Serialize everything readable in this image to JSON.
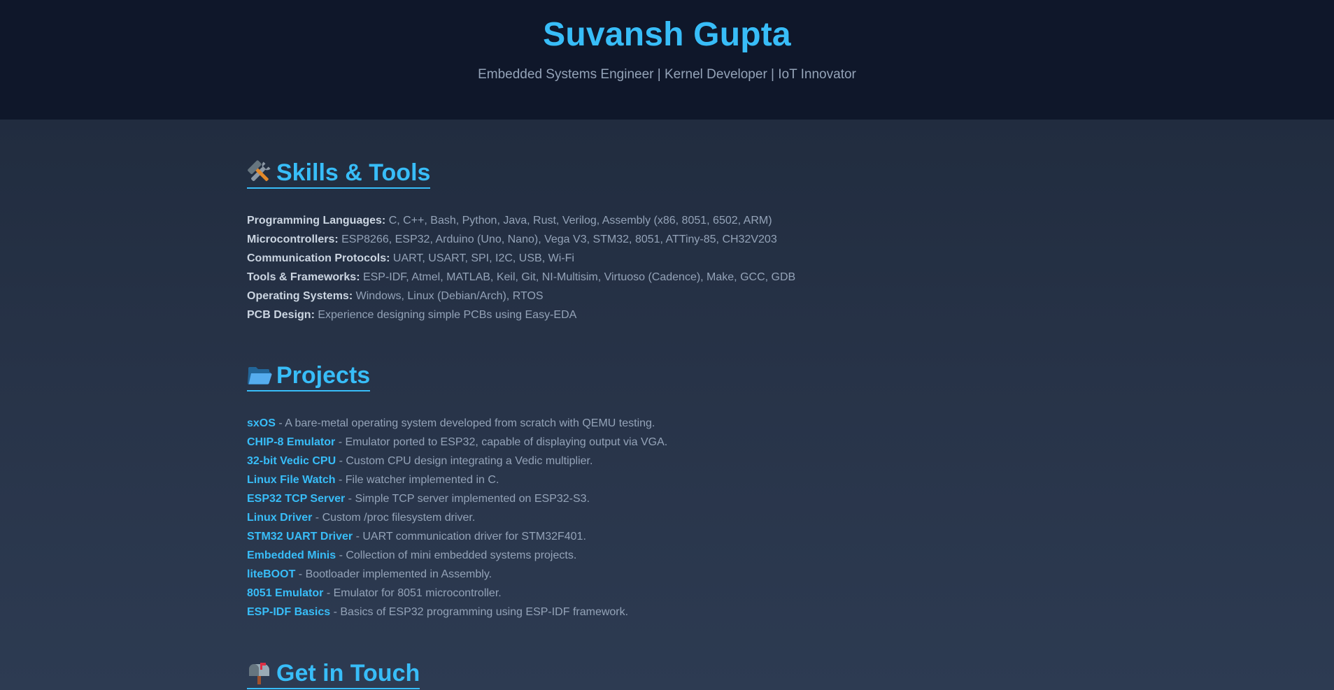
{
  "header": {
    "name": "Suvansh Gupta",
    "tagline": "Embedded Systems Engineer | Kernel Developer | IoT Innovator"
  },
  "skills": {
    "icon": "hammer-and-wrench-icon",
    "title": "Skills & Tools",
    "items": [
      {
        "label": "Programming Languages:",
        "value": " C, C++, Bash, Python, Java, Rust, Verilog, Assembly (x86, 8051, 6502, ARM)"
      },
      {
        "label": "Microcontrollers:",
        "value": " ESP8266, ESP32, Arduino (Uno, Nano), Vega V3, STM32, 8051, ATTiny-85, CH32V203"
      },
      {
        "label": "Communication Protocols:",
        "value": " UART, USART, SPI, I2C, USB, Wi-Fi"
      },
      {
        "label": "Tools & Frameworks:",
        "value": " ESP-IDF, Atmel, MATLAB, Keil, Git, NI-Multisim, Virtuoso (Cadence), Make, GCC, GDB"
      },
      {
        "label": "Operating Systems:",
        "value": " Windows, Linux (Debian/Arch), RTOS"
      },
      {
        "label": "PCB Design:",
        "value": " Experience designing simple PCBs using Easy-EDA"
      }
    ]
  },
  "projects": {
    "icon": "open-folder-icon",
    "title": "Projects",
    "items": [
      {
        "name": "sxOS",
        "desc": " - A bare-metal operating system developed from scratch with QEMU testing."
      },
      {
        "name": "CHIP-8 Emulator",
        "desc": " - Emulator ported to ESP32, capable of displaying output via VGA."
      },
      {
        "name": "32-bit Vedic CPU",
        "desc": " - Custom CPU design integrating a Vedic multiplier."
      },
      {
        "name": "Linux File Watch",
        "desc": " - File watcher implemented in C."
      },
      {
        "name": "ESP32 TCP Server",
        "desc": " - Simple TCP server implemented on ESP32-S3."
      },
      {
        "name": "Linux Driver",
        "desc": " - Custom /proc filesystem driver."
      },
      {
        "name": "STM32 UART Driver",
        "desc": " - UART communication driver for STM32F401."
      },
      {
        "name": "Embedded Minis",
        "desc": " - Collection of mini embedded systems projects."
      },
      {
        "name": "liteBOOT",
        "desc": " - Bootloader implemented in Assembly."
      },
      {
        "name": "8051 Emulator",
        "desc": " - Emulator for 8051 microcontroller."
      },
      {
        "name": "ESP-IDF Basics",
        "desc": " - Basics of ESP32 programming using ESP-IDF framework."
      }
    ]
  },
  "contact": {
    "icon": "mailbox-icon",
    "title": "Get in Touch"
  },
  "colors": {
    "accent": "#38bdf8",
    "header_bg": "#0f172a",
    "body_bg": "#1e293b",
    "muted_text": "#94a3b8",
    "strong_text": "#cbd5e1"
  }
}
